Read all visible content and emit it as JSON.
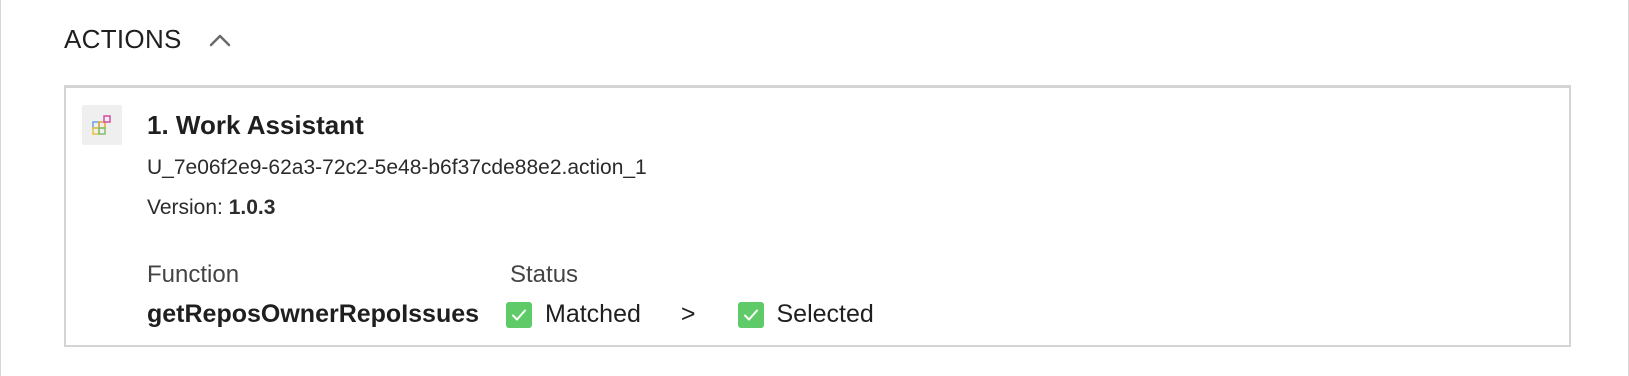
{
  "section": {
    "title": "ACTIONS"
  },
  "action": {
    "title": "1. Work Assistant",
    "id": "U_7e06f2e9-62a3-72c2-5e48-b6f37cde88e2.action_1",
    "version_label": "Version:",
    "version_value": "1.0.3",
    "function_label": "Function",
    "status_label": "Status",
    "function_value": "getReposOwnerRepoIssues",
    "status_matched": "Matched",
    "status_separator": ">",
    "status_selected": "Selected"
  },
  "colors": {
    "check_green": "#5ecb68",
    "border": "#d4d4d4"
  }
}
